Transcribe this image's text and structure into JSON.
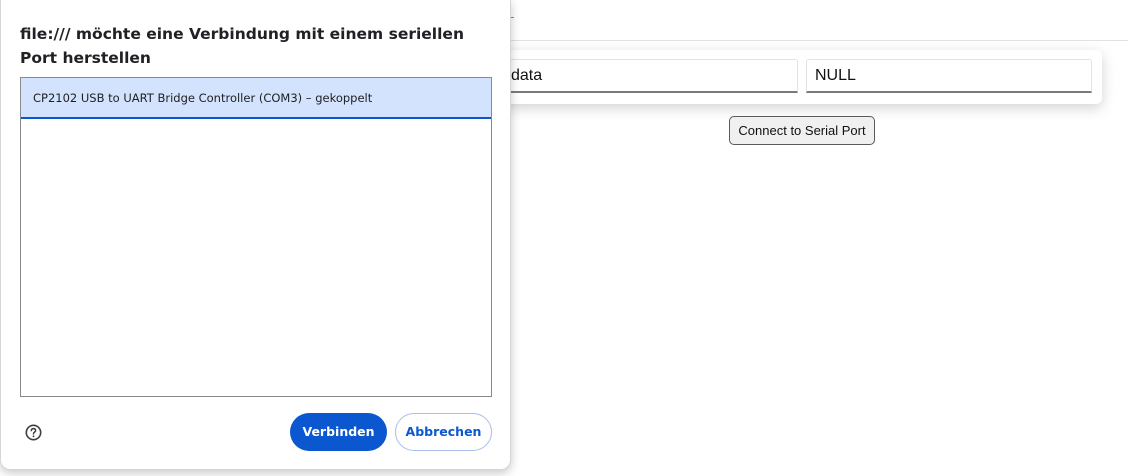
{
  "dialog": {
    "title": "file:/// möchte eine Verbindung mit einem seriellen Port herstellen",
    "ports": [
      {
        "label": "CP2102 USB to UART Bridge Controller (COM3) – gekoppelt",
        "selected": true
      }
    ],
    "help_icon": "help-circle-icon",
    "connect_label": "Verbinden",
    "cancel_label": "Abbrechen"
  },
  "page": {
    "field_data_value": "data",
    "field_null_value": "NULL",
    "connect_serial_label": "Connect to Serial Port"
  },
  "colors": {
    "accent": "#0b57d0",
    "selection": "#d3e3fd"
  }
}
